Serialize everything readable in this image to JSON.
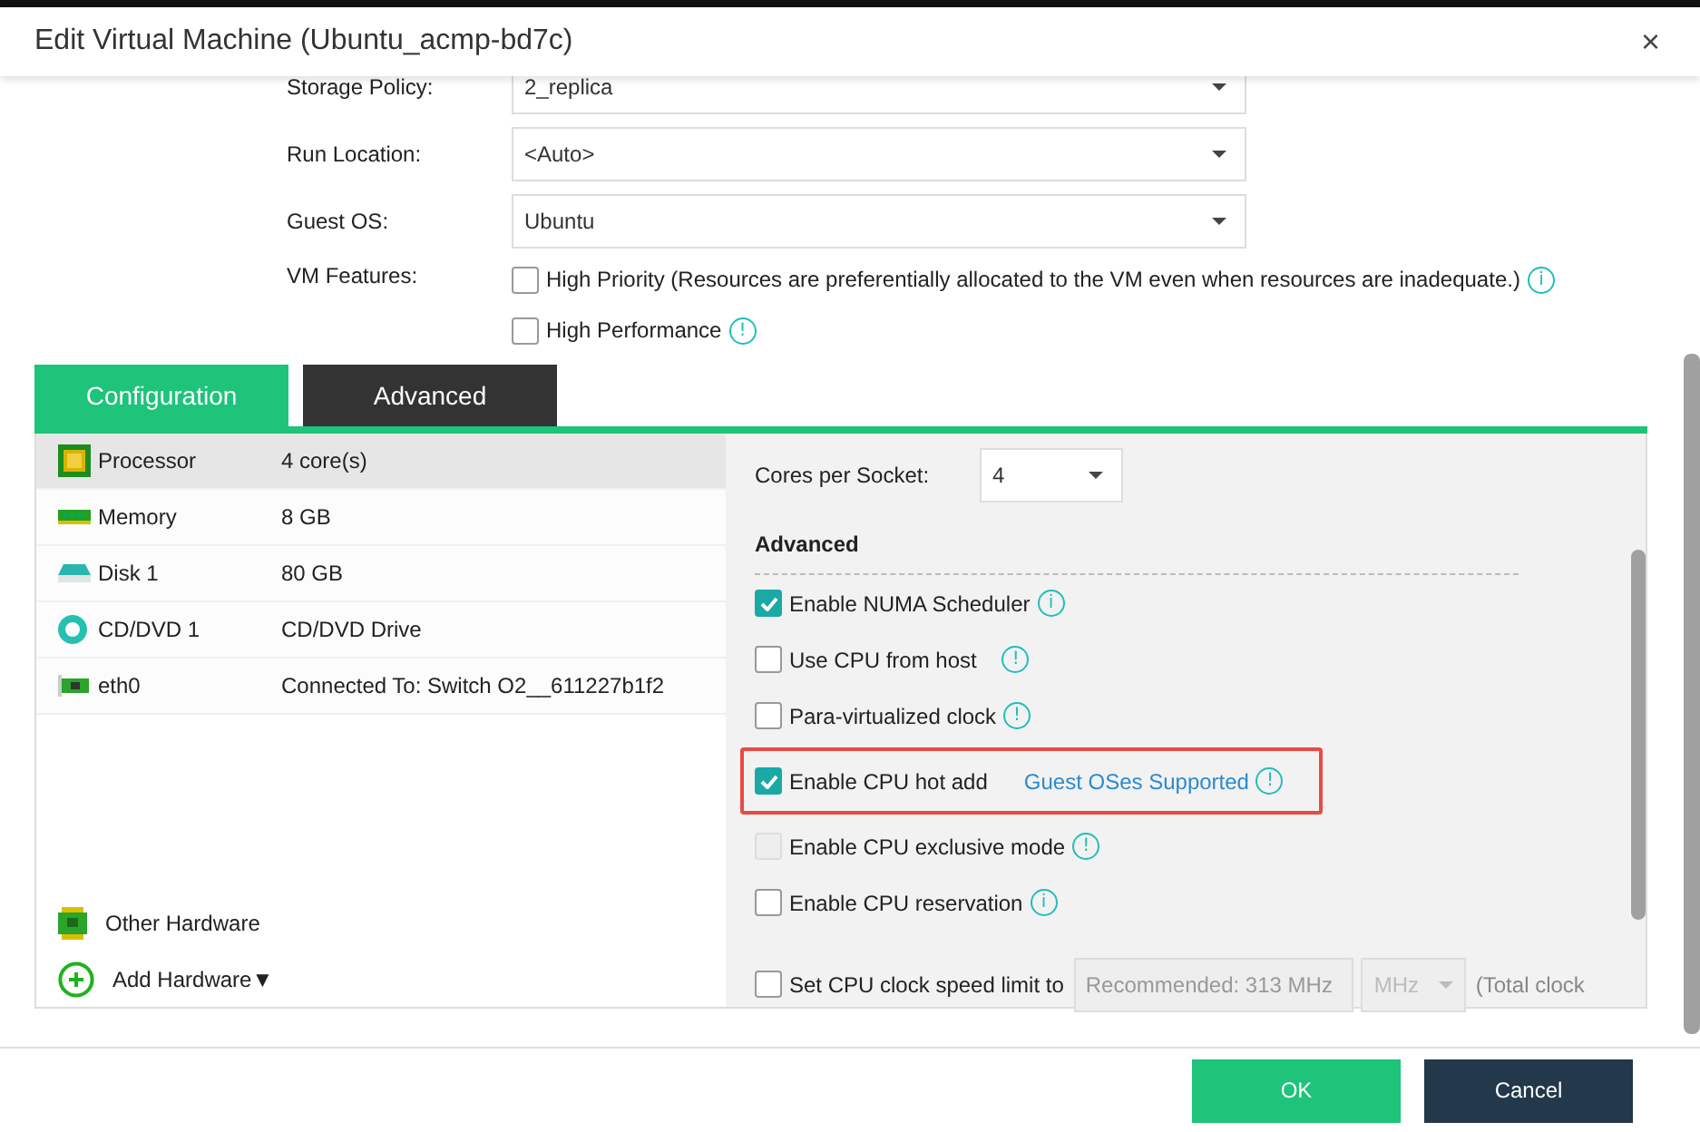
{
  "window": {
    "title": "Edit Virtual Machine (Ubuntu_acmp-bd7c)",
    "close": "×"
  },
  "form": [
    {
      "label": "Storage Policy:",
      "value": "2_replica"
    },
    {
      "label": "Run Location:",
      "value": "<Auto>"
    },
    {
      "label": "Guest OS:",
      "value": "Ubuntu"
    }
  ],
  "vm_features": {
    "label": "VM Features:",
    "options": [
      {
        "label": "High Priority (Resources are preferentially allocated to the VM even when resources are inadequate.)",
        "checked": false,
        "hint": "i"
      },
      {
        "label": "High Performance",
        "checked": false,
        "hint": "!"
      }
    ]
  },
  "tabs": [
    {
      "label": "Configuration",
      "selected": true
    },
    {
      "label": "Advanced",
      "selected": false
    }
  ],
  "hardware": [
    {
      "kind": "processor",
      "name": "Processor",
      "value": "4 core(s)",
      "selected": true
    },
    {
      "kind": "memory",
      "name": "Memory",
      "value": "8 GB",
      "selected": false
    },
    {
      "kind": "disk",
      "name": "Disk 1",
      "value": "80 GB",
      "selected": false
    },
    {
      "kind": "cdrom",
      "name": "CD/DVD 1",
      "value": "CD/DVD Drive",
      "selected": false
    },
    {
      "kind": "nic",
      "name": "eth0",
      "value": "Connected To: Switch O2__611227b1f2",
      "selected": false
    }
  ],
  "other_hardware": "Other Hardware",
  "add_hardware": "Add Hardware▼",
  "cores_per_socket": {
    "label": "Cores per Socket:",
    "value": "4"
  },
  "advanced": {
    "heading": "Advanced",
    "options": [
      {
        "kind": "check",
        "label": "Enable NUMA Scheduler",
        "checked": true,
        "disabled": false,
        "hint": "i"
      },
      {
        "kind": "check",
        "label": "Use CPU from host",
        "checked": false,
        "disabled": false,
        "hint": "!"
      },
      {
        "kind": "check",
        "label": "Para-virtualized clock",
        "checked": false,
        "disabled": false,
        "hint": "!"
      },
      {
        "kind": "link",
        "label": "Enable CPU hot add",
        "checked": true,
        "disabled": false,
        "hint": "!",
        "link": "Guest OSes Supported",
        "highlighted": true
      },
      {
        "kind": "check",
        "label": "Enable CPU exclusive mode",
        "checked": false,
        "disabled": true,
        "hint": "!"
      },
      {
        "kind": "check",
        "label": "Enable CPU reservation",
        "checked": false,
        "disabled": false,
        "hint": "i"
      },
      {
        "kind": "limit",
        "label": "Set CPU clock speed limit to",
        "checked": false,
        "disabled": false,
        "placeholder": "Recommended: 313 MHz",
        "unit": "MHz",
        "suffix": "(Total clock"
      }
    ]
  },
  "buttons": [
    {
      "label": "OK",
      "kind": "primary"
    },
    {
      "label": "Cancel",
      "kind": "secondary"
    }
  ]
}
